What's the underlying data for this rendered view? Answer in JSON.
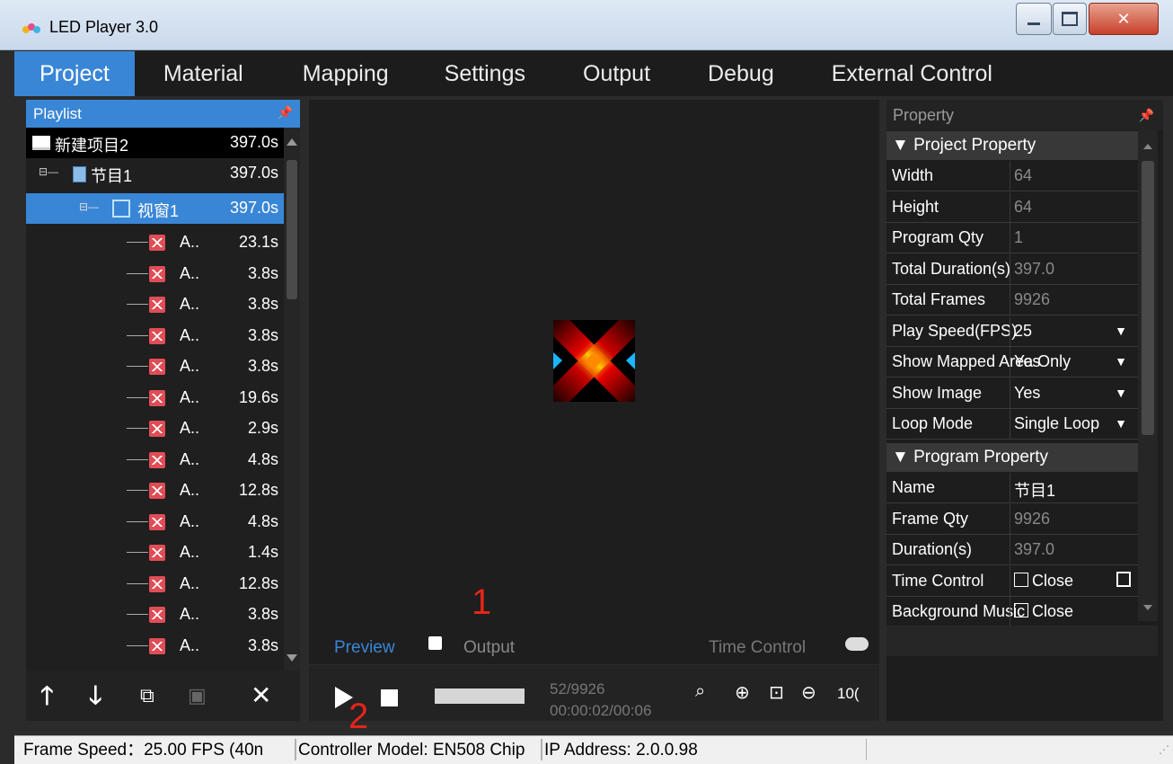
{
  "window": {
    "title": "LED Player 3.0"
  },
  "menu": [
    "Project",
    "Material",
    "Mapping",
    "Settings",
    "Output",
    "Debug",
    "External Control"
  ],
  "playlist": {
    "header": "Playlist",
    "project": {
      "label": "新建项目2",
      "duration": "397.0s"
    },
    "program": {
      "label": "节目1",
      "duration": "397.0s"
    },
    "window": {
      "label": "视窗1",
      "duration": "397.0s"
    },
    "items": [
      {
        "label": "A..",
        "duration": "23.1s"
      },
      {
        "label": "A..",
        "duration": "3.8s"
      },
      {
        "label": "A..",
        "duration": "3.8s"
      },
      {
        "label": "A..",
        "duration": "3.8s"
      },
      {
        "label": "A..",
        "duration": "3.8s"
      },
      {
        "label": "A..",
        "duration": "19.6s"
      },
      {
        "label": "A..",
        "duration": "2.9s"
      },
      {
        "label": "A..",
        "duration": "4.8s"
      },
      {
        "label": "A..",
        "duration": "12.8s"
      },
      {
        "label": "A..",
        "duration": "4.8s"
      },
      {
        "label": "A..",
        "duration": "1.4s"
      },
      {
        "label": "A..",
        "duration": "12.8s"
      },
      {
        "label": "A..",
        "duration": "3.8s"
      },
      {
        "label": "A..",
        "duration": "3.8s"
      }
    ]
  },
  "preview": {
    "tab_preview": "Preview",
    "tab_output": "Output",
    "time_control": "Time Control",
    "annotation_1": "1",
    "annotation_2": "2",
    "frame_counter": "52/9926",
    "time_counter": "00:00:02/00:06",
    "zoom": "10("
  },
  "property": {
    "header": "Property",
    "project_section": "▼ Project Property",
    "project_rows": [
      {
        "key": "Width",
        "value": "64"
      },
      {
        "key": "Height",
        "value": "64"
      },
      {
        "key": "Program Qty",
        "value": "1"
      },
      {
        "key": "Total Duration(s)",
        "value": "397.0"
      },
      {
        "key": "Total Frames",
        "value": "9926"
      },
      {
        "key": "Play Speed(FPS)",
        "value": "25"
      },
      {
        "key": "Show Mapped Area Only",
        "value": "Yes"
      },
      {
        "key": "Show Image",
        "value": "Yes"
      },
      {
        "key": "Loop Mode",
        "value": "Single Loop"
      }
    ],
    "program_section": "▼ Program Property",
    "program_rows": [
      {
        "key": "Name",
        "value": "节目1"
      },
      {
        "key": "Frame Qty",
        "value": "9926"
      },
      {
        "key": "Duration(s)",
        "value": "397.0"
      },
      {
        "key": "Time Control",
        "value": "Close"
      },
      {
        "key": "Background Music",
        "value": "Close"
      }
    ]
  },
  "status": {
    "frame_speed": "Frame Speed：25.00 FPS (40n",
    "controller": "Controller Model: EN508  Chip",
    "ip": "IP Address: 2.0.0.98"
  },
  "colors": {
    "accent": "#3a86d6",
    "annotation": "#e5241a"
  }
}
